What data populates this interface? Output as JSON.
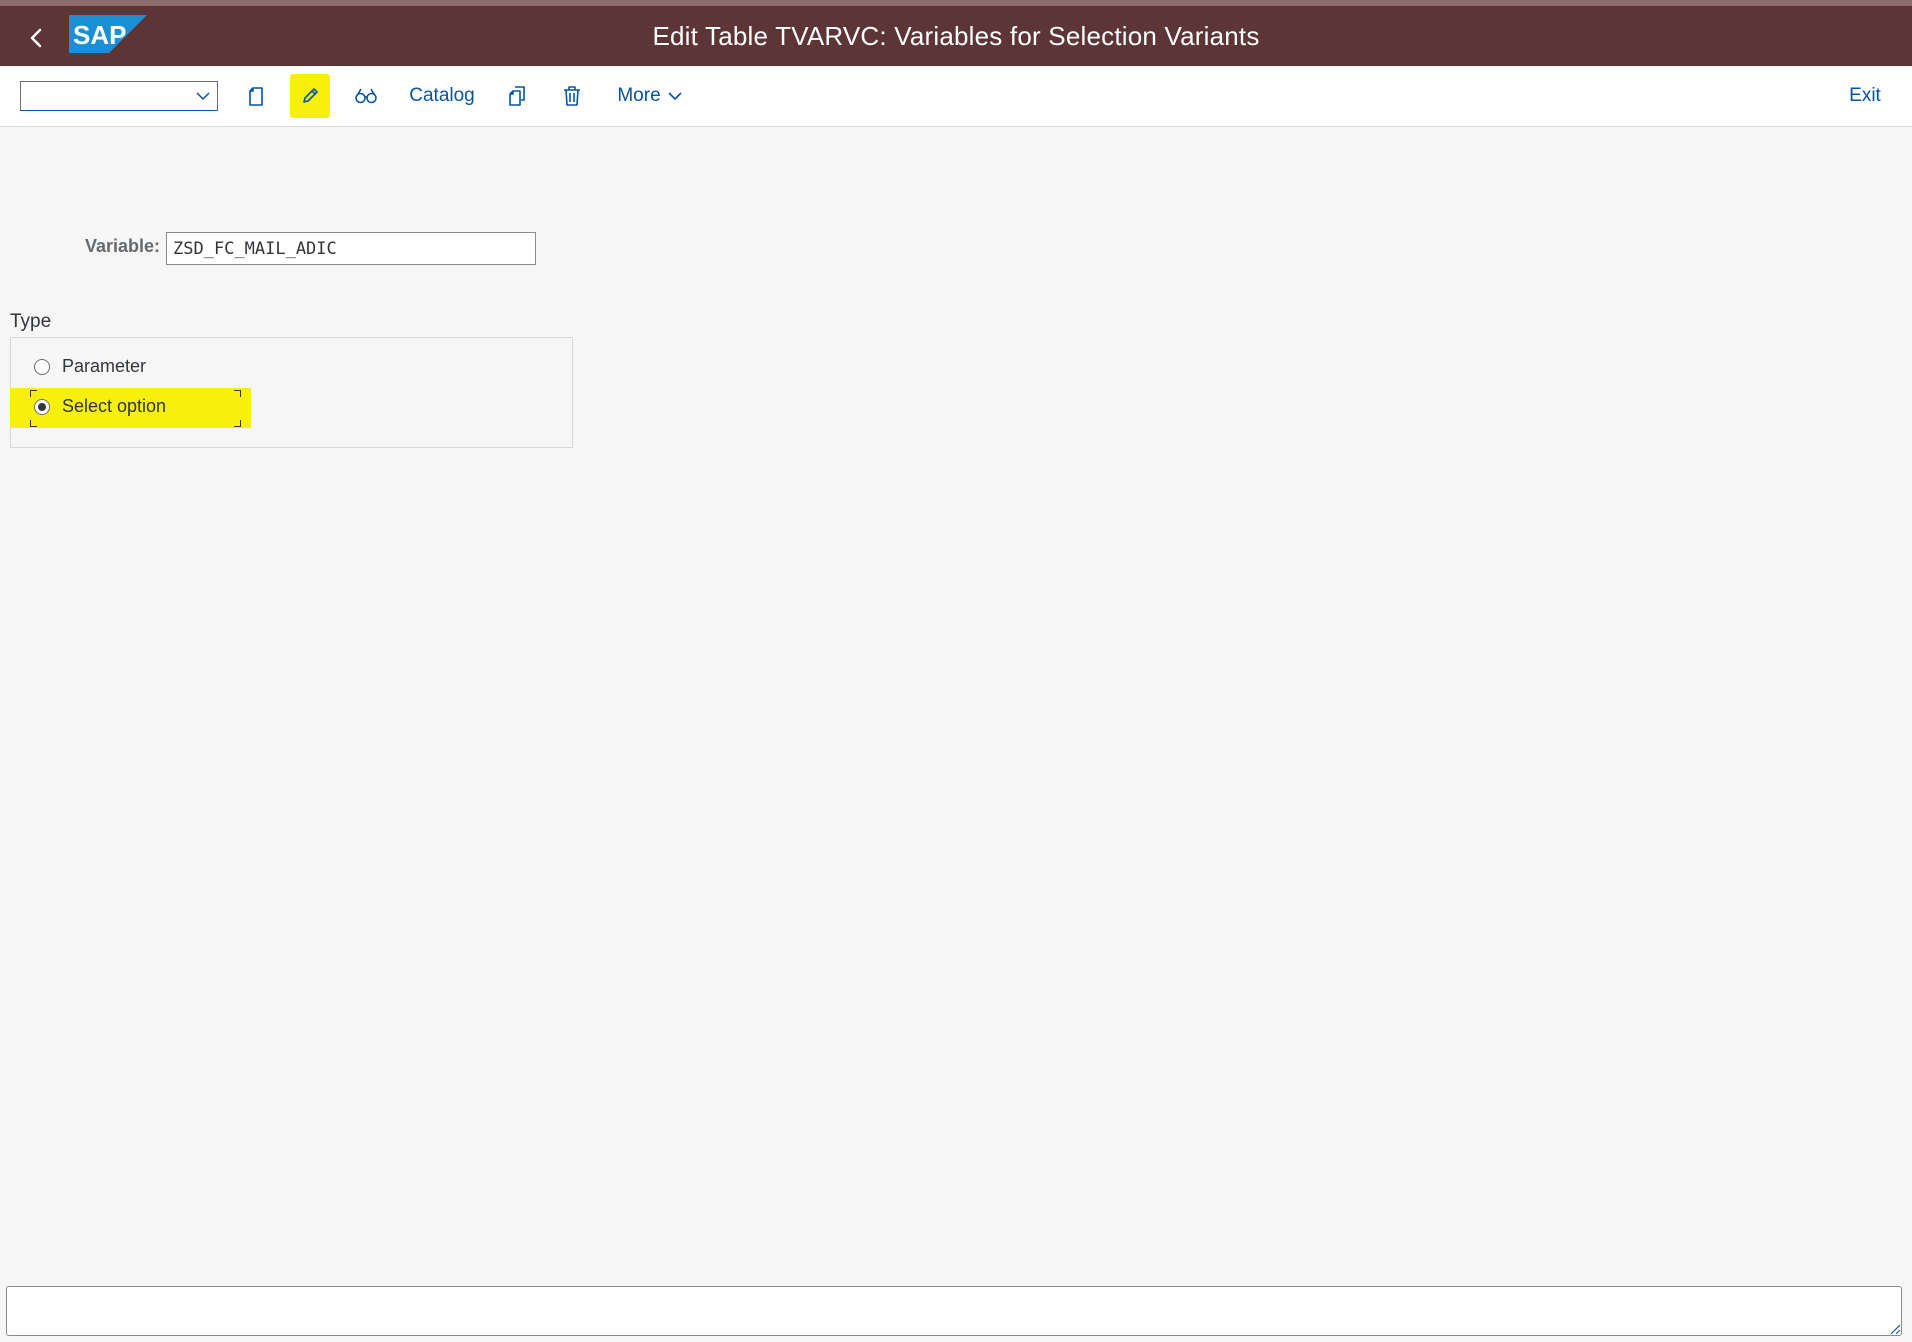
{
  "header": {
    "title": "Edit Table TVARVC: Variables for Selection Variants",
    "logo_text": "SAP",
    "background": "#5e3536"
  },
  "toolbar": {
    "select_value": "",
    "catalog_label": "Catalog",
    "more_label": "More",
    "exit_label": "Exit",
    "highlight_color": "#f6f00c",
    "icons": [
      "back-icon",
      "new-document-icon",
      "pencil-icon",
      "binoculars-icon",
      "copy-icon",
      "trash-icon",
      "chevron-down-icon"
    ]
  },
  "form": {
    "variable_label": "Variable:",
    "variable_value": "ZSD_FC_MAIL_ADIC",
    "type_title": "Type",
    "type_options": [
      {
        "label": "Parameter",
        "checked": false
      },
      {
        "label": "Select option",
        "checked": true
      }
    ]
  },
  "status": {
    "message": ""
  }
}
